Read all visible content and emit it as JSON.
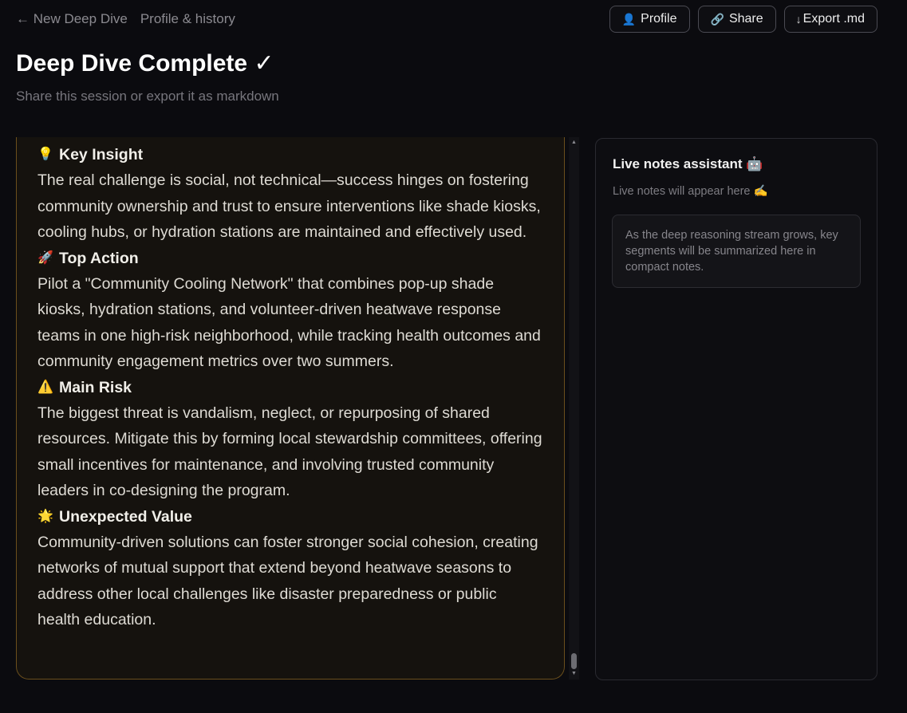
{
  "nav": {
    "back_label": "← New Deep Dive",
    "history_label": "Profile & history"
  },
  "actions": {
    "profile": {
      "icon": "👤",
      "label": "Profile"
    },
    "share": {
      "icon": "🔗",
      "label": "Share"
    },
    "export": {
      "icon": "↓",
      "label": "Export .md"
    }
  },
  "header": {
    "title": "Deep Dive Complete ✓",
    "subtitle": "Share this session or export it as markdown"
  },
  "sections": [
    {
      "emoji": "💡",
      "heading": "Key Insight",
      "body": "The real challenge is social, not technical—success hinges on fostering community ownership and trust to ensure interventions like shade kiosks, cooling hubs, or hydration stations are maintained and effectively used."
    },
    {
      "emoji": "🚀",
      "heading": "Top Action",
      "body": "Pilot a \"Community Cooling Network\" that combines pop-up shade kiosks, hydration stations, and volunteer-driven heatwave response teams in one high-risk neighborhood, while tracking health outcomes and community engagement metrics over two summers."
    },
    {
      "emoji": "⚠️",
      "heading": "Main Risk",
      "body": "The biggest threat is vandalism, neglect, or repurposing of shared resources. Mitigate this by forming local stewardship committees, offering small incentives for maintenance, and involving trusted community leaders in co-designing the program."
    },
    {
      "emoji": "🌟",
      "heading": "Unexpected Value",
      "body": "Community-driven solutions can foster stronger social cohesion, creating networks of mutual support that extend beyond heatwave seasons to address other local challenges like disaster preparedness or public health education."
    }
  ],
  "notes": {
    "title": "Live notes assistant 🤖",
    "hint": "Live notes will appear here ✍️",
    "placeholder": "As the deep reasoning stream grows, key segments will be summarized here in compact notes."
  }
}
